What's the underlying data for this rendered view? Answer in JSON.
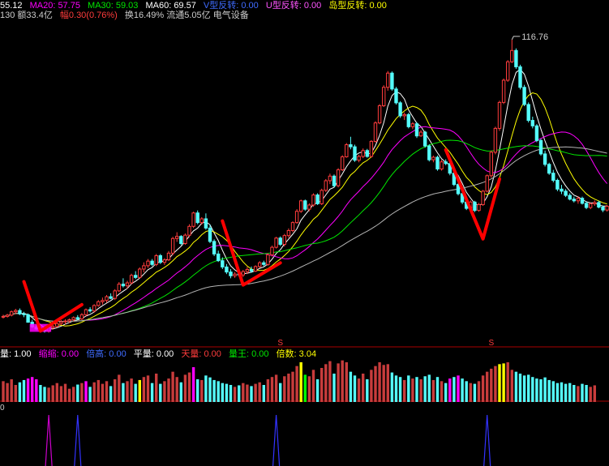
{
  "colors": {
    "up": "#ff3c3c",
    "down": "#54fcfc",
    "ma5": "#ffffff",
    "ma10": "#ffff00",
    "ma20": "#ff00ff",
    "ma30": "#00e600",
    "ma60": "#b4b4b4",
    "pattern": "#ff0000",
    "hl_mag": "#ff00ff",
    "hl_yel": "#ffff00",
    "hl_grn": "#00ff00",
    "sig_m": "#cc00cc",
    "sig_b": "#3333ff"
  },
  "legend_top": [
    {
      "text": "55.12",
      "color": "#ffffff"
    },
    {
      "text": "MA20: 57.75",
      "color": "#ff00ff"
    },
    {
      "text": "MA30: 59.03",
      "color": "#00e600"
    },
    {
      "text": "MA60: 69.57",
      "color": "#ffffff"
    },
    {
      "text": "V型反转: 0.00",
      "color": "#3f6bff"
    },
    {
      "text": "U型反转: 0.00",
      "color": "#ff55ff"
    },
    {
      "text": "岛型反转: 0.00",
      "color": "#ffff00"
    }
  ],
  "legend_info": [
    {
      "text": "130 额33.4亿",
      "color": "#cccccc"
    },
    {
      "text": "幅0.30(0.76%)",
      "color": "#ff3c3c"
    },
    {
      "text": "换16.49% 流通5.05亿 电气设备",
      "color": "#cccccc"
    }
  ],
  "legend_volume": [
    {
      "text": "量: 1.00",
      "color": "#ffffff"
    },
    {
      "text": "缩缩: 0.00",
      "color": "#ff00ff"
    },
    {
      "text": "倍高: 0.00",
      "color": "#3f6bff"
    },
    {
      "text": "平量: 0.00",
      "color": "#ffffff"
    },
    {
      "text": "天量: 0.00",
      "color": "#ff3c3c"
    },
    {
      "text": "量王: 0.00",
      "color": "#00e600"
    },
    {
      "text": "倍数: 3.04",
      "color": "#ffff00"
    }
  ],
  "legend_signal": [
    {
      "text": "0",
      "color": "#cccccc"
    }
  ],
  "labels": {
    "high_price": "116.76",
    "s_marker_1": "S",
    "s_marker_2": "S"
  },
  "chart_data": {
    "type": "candlestick",
    "ylim": [
      44,
      122
    ],
    "vlim": [
      0,
      1.2
    ],
    "candles": [
      [
        50.5,
        51.1,
        50.2,
        50.7
      ],
      [
        50.7,
        51.3,
        50.4,
        51.0
      ],
      [
        51.0,
        52.1,
        50.7,
        51.8
      ],
      [
        51.8,
        52.5,
        51.2,
        52.1
      ],
      [
        52.1,
        52.6,
        51.0,
        51.3
      ],
      [
        51.3,
        51.8,
        50.5,
        51.1
      ],
      [
        51.1,
        51.4,
        49.2,
        49.3
      ],
      [
        49.3,
        49.9,
        47.9,
        48.2
      ],
      [
        48.2,
        48.7,
        47.4,
        47.7
      ],
      [
        47.7,
        48.2,
        47.1,
        47.4
      ],
      [
        47.4,
        47.8,
        46.8,
        47.2
      ],
      [
        47.2,
        48.2,
        46.8,
        48.0
      ],
      [
        48.0,
        48.7,
        47.5,
        48.3
      ],
      [
        48.3,
        49.3,
        48.0,
        49.0
      ],
      [
        49.0,
        49.8,
        48.6,
        49.4
      ],
      [
        49.4,
        50.0,
        48.8,
        49.6
      ],
      [
        49.6,
        50.2,
        49.1,
        49.9
      ],
      [
        49.9,
        50.7,
        49.5,
        50.4
      ],
      [
        50.4,
        51.0,
        49.8,
        50.1
      ],
      [
        50.1,
        51.5,
        49.8,
        51.1
      ],
      [
        51.1,
        52.6,
        50.7,
        52.3
      ],
      [
        52.3,
        52.9,
        51.6,
        52.0
      ],
      [
        52.0,
        53.6,
        51.6,
        53.3
      ],
      [
        53.3,
        54.6,
        53.0,
        54.2
      ],
      [
        54.2,
        55.2,
        53.5,
        54.5
      ],
      [
        54.5,
        55.8,
        54.0,
        55.4
      ],
      [
        55.4,
        56.2,
        54.8,
        55.0
      ],
      [
        55.0,
        57.2,
        54.6,
        56.8
      ],
      [
        56.8,
        58.9,
        56.5,
        58.4
      ],
      [
        58.4,
        59.8,
        57.6,
        58.0
      ],
      [
        58.0,
        59.2,
        57.3,
        58.7
      ],
      [
        58.7,
        60.9,
        58.3,
        60.5
      ],
      [
        60.5,
        61.5,
        59.6,
        60.0
      ],
      [
        60.0,
        62.4,
        59.7,
        62.0
      ],
      [
        62.0,
        63.6,
        61.2,
        62.8
      ],
      [
        62.8,
        64.4,
        62.3,
        63.9
      ],
      [
        63.9,
        64.4,
        62.7,
        63.1
      ],
      [
        63.1,
        65.6,
        62.7,
        65.2
      ],
      [
        65.2,
        65.6,
        63.2,
        63.6
      ],
      [
        63.6,
        64.6,
        63.0,
        64.2
      ],
      [
        64.2,
        66.3,
        63.9,
        65.8
      ],
      [
        65.8,
        69.7,
        65.3,
        69.3
      ],
      [
        69.3,
        70.8,
        68.5,
        69.8
      ],
      [
        69.8,
        70.1,
        67.7,
        68.1
      ],
      [
        68.1,
        70.5,
        67.8,
        70.1
      ],
      [
        70.1,
        72.7,
        69.6,
        72.2
      ],
      [
        72.2,
        75.7,
        71.8,
        75.4
      ],
      [
        75.4,
        76.0,
        72.7,
        73.1
      ],
      [
        73.1,
        74.4,
        72.6,
        74.0
      ],
      [
        74.0,
        75.3,
        71.4,
        71.8
      ],
      [
        71.8,
        72.6,
        68.2,
        68.6
      ],
      [
        68.6,
        69.1,
        65.1,
        65.6
      ],
      [
        65.6,
        66.4,
        63.7,
        64.0
      ],
      [
        64.0,
        64.8,
        62.0,
        62.5
      ],
      [
        62.5,
        63.2,
        60.8,
        61.3
      ],
      [
        61.3,
        62.0,
        59.8,
        60.4
      ],
      [
        60.4,
        61.3,
        59.9,
        60.8
      ],
      [
        60.8,
        61.4,
        60.2,
        60.6
      ],
      [
        60.6,
        61.8,
        60.1,
        61.4
      ],
      [
        61.4,
        62.5,
        60.8,
        61.9
      ],
      [
        61.9,
        62.6,
        61.1,
        61.5
      ],
      [
        61.5,
        62.9,
        61.3,
        62.6
      ],
      [
        62.6,
        63.9,
        62.3,
        63.5
      ],
      [
        63.5,
        64.0,
        62.7,
        63.1
      ],
      [
        63.1,
        65.8,
        62.8,
        65.4
      ],
      [
        65.4,
        67.6,
        65.0,
        67.2
      ],
      [
        67.2,
        69.7,
        66.9,
        69.4
      ],
      [
        69.4,
        69.8,
        67.5,
        67.9
      ],
      [
        67.9,
        70.4,
        67.4,
        70.0
      ],
      [
        70.0,
        71.7,
        69.5,
        71.2
      ],
      [
        71.2,
        73.4,
        70.8,
        73.1
      ],
      [
        73.1,
        76.3,
        72.8,
        75.8
      ],
      [
        75.8,
        78.6,
        75.4,
        78.3
      ],
      [
        78.3,
        78.6,
        75.9,
        76.3
      ],
      [
        76.3,
        77.7,
        75.8,
        77.3
      ],
      [
        77.3,
        80.1,
        76.9,
        79.7
      ],
      [
        79.7,
        80.1,
        77.3,
        77.6
      ],
      [
        77.6,
        81.2,
        77.3,
        80.8
      ],
      [
        80.8,
        83.5,
        80.4,
        83.1
      ],
      [
        83.1,
        84.8,
        82.3,
        84.2
      ],
      [
        84.2,
        84.6,
        81.5,
        81.9
      ],
      [
        81.9,
        86.1,
        81.5,
        85.7
      ],
      [
        85.7,
        89.2,
        85.4,
        88.8
      ],
      [
        88.8,
        92.1,
        88.6,
        91.7
      ],
      [
        91.7,
        93.6,
        90.6,
        91.2
      ],
      [
        91.2,
        91.7,
        87.6,
        88.0
      ],
      [
        88.0,
        89.3,
        87.5,
        88.9
      ],
      [
        88.9,
        90.8,
        88.5,
        90.3
      ],
      [
        90.3,
        90.7,
        88.6,
        88.9
      ],
      [
        88.9,
        92.8,
        88.6,
        92.5
      ],
      [
        92.5,
        97.3,
        92.2,
        96.9
      ],
      [
        96.9,
        101.4,
        96.6,
        101.0
      ],
      [
        101.0,
        105.9,
        100.7,
        105.4
      ],
      [
        105.4,
        109.3,
        104.6,
        108.8
      ],
      [
        108.8,
        109.2,
        104.6,
        105.0
      ],
      [
        105.0,
        105.5,
        101.3,
        101.7
      ],
      [
        101.7,
        102.1,
        98.1,
        98.6
      ],
      [
        98.6,
        99.4,
        97.6,
        98.9
      ],
      [
        98.9,
        99.3,
        95.6,
        96.0
      ],
      [
        96.0,
        97.1,
        95.4,
        96.7
      ],
      [
        96.7,
        97.1,
        93.3,
        93.8
      ],
      [
        93.8,
        95.2,
        93.6,
        94.7
      ],
      [
        94.7,
        95.0,
        91.0,
        91.4
      ],
      [
        91.4,
        91.8,
        87.7,
        88.1
      ],
      [
        88.1,
        89.1,
        87.5,
        88.7
      ],
      [
        88.7,
        89.1,
        85.5,
        85.9
      ],
      [
        85.9,
        88.1,
        85.5,
        87.6
      ],
      [
        87.6,
        88.2,
        86.8,
        87.2
      ],
      [
        87.2,
        87.6,
        84.4,
        84.9
      ],
      [
        84.9,
        85.3,
        81.8,
        82.2
      ],
      [
        82.2,
        82.6,
        79.6,
        80.0
      ],
      [
        80.0,
        80.7,
        77.5,
        78.0
      ],
      [
        78.0,
        78.6,
        76.1,
        76.5
      ],
      [
        76.5,
        78.4,
        76.1,
        78.0
      ],
      [
        78.0,
        78.3,
        75.6,
        76.0
      ],
      [
        76.0,
        77.8,
        75.7,
        77.4
      ],
      [
        77.4,
        80.9,
        77.1,
        80.6
      ],
      [
        80.6,
        84.6,
        80.3,
        84.3
      ],
      [
        84.3,
        90.3,
        83.8,
        89.9
      ],
      [
        89.9,
        96.0,
        89.4,
        95.6
      ],
      [
        95.6,
        102.2,
        95.0,
        101.8
      ],
      [
        101.8,
        107.5,
        101.4,
        107.1
      ],
      [
        107.1,
        111.9,
        106.7,
        111.5
      ],
      [
        111.5,
        116.8,
        111.2,
        114.2
      ],
      [
        114.2,
        114.7,
        109.8,
        110.3
      ],
      [
        110.3,
        110.8,
        104.9,
        105.4
      ],
      [
        105.4,
        106.0,
        100.9,
        101.3
      ],
      [
        101.3,
        101.8,
        97.0,
        97.5
      ],
      [
        97.5,
        98.4,
        95.6,
        96.2
      ],
      [
        96.2,
        96.6,
        92.3,
        92.7
      ],
      [
        92.7,
        93.1,
        89.1,
        89.5
      ],
      [
        89.5,
        90.3,
        86.5,
        87.0
      ],
      [
        87.0,
        87.4,
        84.5,
        84.9
      ],
      [
        84.9,
        85.7,
        82.7,
        83.2
      ],
      [
        83.2,
        83.6,
        80.6,
        81.1
      ],
      [
        81.1,
        82.1,
        79.9,
        80.6
      ],
      [
        80.6,
        81.1,
        79.2,
        79.6
      ],
      [
        79.6,
        80.1,
        78.4,
        78.7
      ],
      [
        78.7,
        79.3,
        77.9,
        78.3
      ],
      [
        78.3,
        79.4,
        77.6,
        78.9
      ],
      [
        78.9,
        79.3,
        77.4,
        77.7
      ],
      [
        77.7,
        78.2,
        76.3,
        76.7
      ],
      [
        76.7,
        77.9,
        76.3,
        77.6
      ],
      [
        77.6,
        78.4,
        77.1,
        77.9
      ],
      [
        77.9,
        78.3,
        76.5,
        76.8
      ],
      [
        76.8,
        77.2,
        75.6,
        76.1
      ],
      [
        76.1,
        77.3,
        75.7,
        77.0
      ]
    ],
    "volumes": [
      0.55,
      0.5,
      0.6,
      0.45,
      0.52,
      0.58,
      0.62,
      0.66,
      0.6,
      0.45,
      0.4,
      0.38,
      0.44,
      0.5,
      0.42,
      0.48,
      0.35,
      0.4,
      0.46,
      0.5,
      0.55,
      0.4,
      0.52,
      0.58,
      0.48,
      0.55,
      0.42,
      0.6,
      0.72,
      0.5,
      0.55,
      0.62,
      0.48,
      0.58,
      0.66,
      0.7,
      0.5,
      0.75,
      0.48,
      0.55,
      0.62,
      0.8,
      0.66,
      0.52,
      0.72,
      0.78,
      0.92,
      0.6,
      0.58,
      0.7,
      0.65,
      0.58,
      0.55,
      0.5,
      0.48,
      0.45,
      0.4,
      0.44,
      0.5,
      0.46,
      0.42,
      0.48,
      0.52,
      0.45,
      0.6,
      0.66,
      0.72,
      0.5,
      0.68,
      0.75,
      0.8,
      0.95,
      1.05,
      0.72,
      0.68,
      0.85,
      0.6,
      0.9,
      1.0,
      1.08,
      0.75,
      1.02,
      1.1,
      1.05,
      0.8,
      0.7,
      0.62,
      0.75,
      0.6,
      0.85,
      0.95,
      1.05,
      0.98,
      1.0,
      0.78,
      0.7,
      0.66,
      0.58,
      0.7,
      0.62,
      0.66,
      0.6,
      0.68,
      0.72,
      0.58,
      0.66,
      0.55,
      0.5,
      0.62,
      0.66,
      0.7,
      0.62,
      0.55,
      0.5,
      0.48,
      0.55,
      0.7,
      0.8,
      0.88,
      0.95,
      1.0,
      1.02,
      1.05,
      0.85,
      0.8,
      0.75,
      0.7,
      0.72,
      0.66,
      0.62,
      0.6,
      0.65,
      0.58,
      0.55,
      0.5,
      0.52,
      0.48,
      0.5,
      0.45,
      0.42,
      0.48,
      0.45,
      0.4,
      0.44
    ],
    "vol_highlight": [
      [
        6,
        "hl_mag"
      ],
      [
        7,
        "hl_mag"
      ],
      [
        8,
        "hl_mag"
      ],
      [
        20,
        "hl_mag"
      ],
      [
        33,
        "hl_yel"
      ],
      [
        46,
        "hl_mag"
      ],
      [
        72,
        "hl_yel"
      ],
      [
        73,
        "hl_grn"
      ],
      [
        108,
        "hl_mag"
      ],
      [
        110,
        "hl_mag"
      ],
      [
        120,
        "hl_yel"
      ],
      [
        121,
        "hl_yel"
      ]
    ],
    "pattern_lines": [
      [
        [
          5,
          59.0
        ],
        [
          9,
          47.2
        ],
        [
          19,
          53.5
        ]
      ],
      [
        [
          53,
          73.5
        ],
        [
          58,
          58.2
        ],
        [
          67,
          63.5
        ]
      ],
      [
        [
          107,
          90.5
        ],
        [
          116,
          69.2
        ],
        [
          120,
          83.5
        ]
      ]
    ],
    "s_markers": [
      67,
      118
    ],
    "signals": [
      [
        11,
        "sig_m"
      ],
      [
        18,
        "sig_b"
      ],
      [
        66,
        "sig_b"
      ],
      [
        117,
        "sig_b"
      ]
    ]
  }
}
